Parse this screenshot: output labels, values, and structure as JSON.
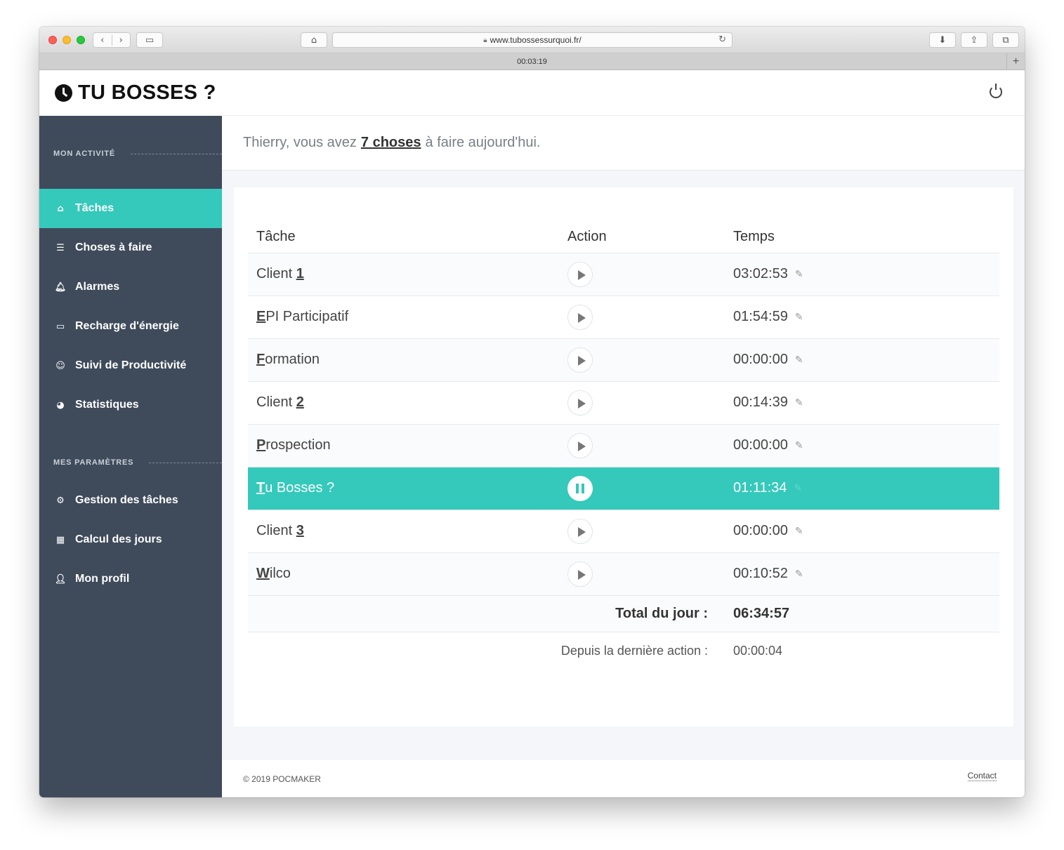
{
  "browser": {
    "url": "www.tubossessurquoi.fr/",
    "tab_title": "00:03:19"
  },
  "app": {
    "brand": "TU BOSSES ?"
  },
  "sidebar": {
    "section1": "MON ACTIVITÉ",
    "section2": "MES PARAMÈTRES",
    "items": [
      {
        "label": "Tâches",
        "icon": "home-icon"
      },
      {
        "label": "Choses à faire",
        "icon": "list-icon"
      },
      {
        "label": "Alarmes",
        "icon": "bell-icon"
      },
      {
        "label": "Recharge d'énergie",
        "icon": "battery-icon"
      },
      {
        "label": "Suivi de Productivité",
        "icon": "smiley-icon"
      },
      {
        "label": "Statistiques",
        "icon": "pie-chart-icon"
      },
      {
        "label": "Gestion des tâches",
        "icon": "gear-icon"
      },
      {
        "label": "Calcul des jours",
        "icon": "calculator-icon"
      },
      {
        "label": "Mon profil",
        "icon": "user-icon"
      }
    ]
  },
  "greeting": {
    "before": "Thierry, vous avez",
    "link": "7 choses",
    "after": "à faire aujourd'hui."
  },
  "table": {
    "headers": [
      "Tâche",
      "Action",
      "Temps"
    ],
    "rows": [
      {
        "first": "Client ",
        "underlined": "1",
        "rest": "",
        "time": "03:02:53",
        "running": false
      },
      {
        "first": "",
        "underlined": "E",
        "rest": "PI Participatif",
        "time": "01:54:59",
        "running": false
      },
      {
        "first": "",
        "underlined": "F",
        "rest": "ormation",
        "time": "00:00:00",
        "running": false
      },
      {
        "first": "Client ",
        "underlined": "2",
        "rest": "",
        "time": "00:14:39",
        "running": false
      },
      {
        "first": "",
        "underlined": "P",
        "rest": "rospection",
        "time": "00:00:00",
        "running": false
      },
      {
        "first": "",
        "underlined": "T",
        "rest": "u Bosses ?",
        "time": "01:11:34",
        "running": true
      },
      {
        "first": "Client ",
        "underlined": "3",
        "rest": "",
        "time": "00:00:00",
        "running": false
      },
      {
        "first": "",
        "underlined": "W",
        "rest": "ilco",
        "time": "00:10:52",
        "running": false
      }
    ],
    "total_label": "Total du jour :",
    "total_value": "06:34:57",
    "since_label": "Depuis la dernière action :",
    "since_value": "00:00:04"
  },
  "footer": {
    "copyright": "© 2019 POCMAKER",
    "contact": "Contact"
  },
  "colors": {
    "accent": "#34c9bb",
    "sidebar": "#3f4b5b"
  }
}
